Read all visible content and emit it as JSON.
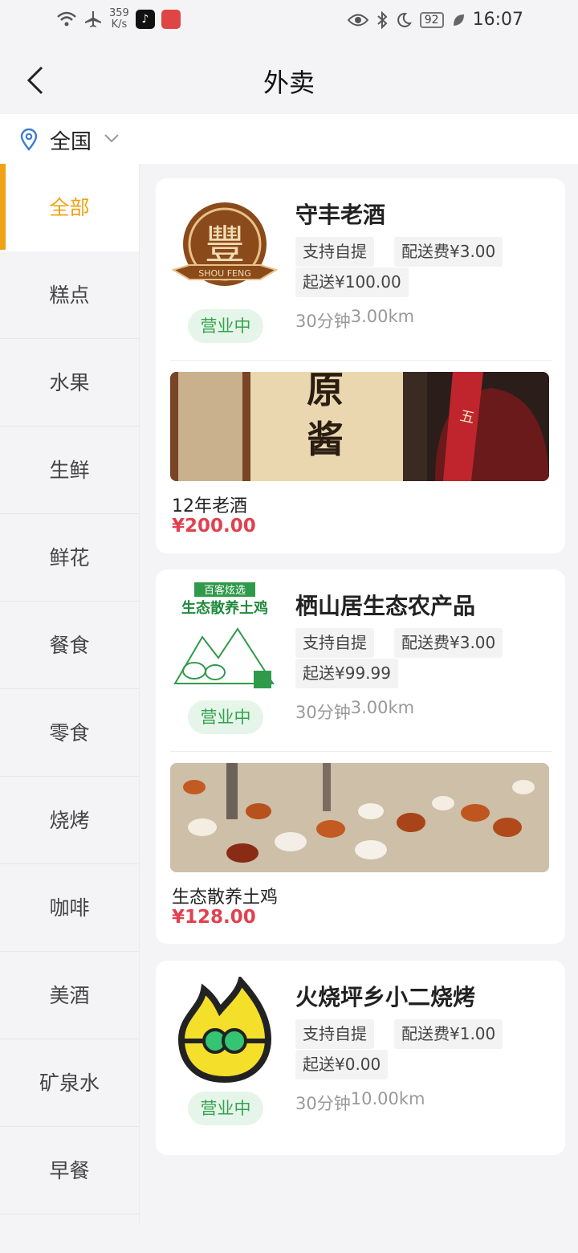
{
  "status": {
    "speed_value": "359",
    "speed_unit": "K/s",
    "battery": "92",
    "time": "16:07"
  },
  "header": {
    "title": "外卖"
  },
  "location": {
    "label": "全国"
  },
  "categories": [
    "全部",
    "糕点",
    "水果",
    "生鲜",
    "鲜花",
    "餐食",
    "零食",
    "烧烤",
    "咖啡",
    "美酒",
    "矿泉水",
    "早餐"
  ],
  "active_category": "全部",
  "stores": [
    {
      "name": "守丰老酒",
      "logo_text": "SHOU FENG",
      "status": "营业中",
      "pickup": "支持自提",
      "delivery_fee": "配送费¥3.00",
      "min_order": "起送¥100.00",
      "time": "30分钟",
      "distance": "3.00km",
      "product": {
        "name": "12年老酒",
        "price": "¥200.00",
        "photo_text_1": "原",
        "photo_text_2": "酱",
        "photo_text_3": "五千年文"
      }
    },
    {
      "name": "栖山居生态农产品",
      "logo_text_1": "百客炫选",
      "logo_text_2": "生态散养土鸡",
      "status": "营业中",
      "pickup": "支持自提",
      "delivery_fee": "配送费¥3.00",
      "min_order": "起送¥99.99",
      "time": "30分钟",
      "distance": "3.00km",
      "product": {
        "name": "生态散养土鸡",
        "price": "¥128.00"
      }
    },
    {
      "name": "火烧坪乡小二烧烤",
      "status": "营业中",
      "pickup": "支持自提",
      "delivery_fee": "配送费¥1.00",
      "min_order": "起送¥0.00",
      "time": "30分钟",
      "distance": "10.00km"
    }
  ],
  "colors": {
    "accent": "#f0a215",
    "open_green": "#35a24f",
    "price_red": "#e0414f"
  }
}
